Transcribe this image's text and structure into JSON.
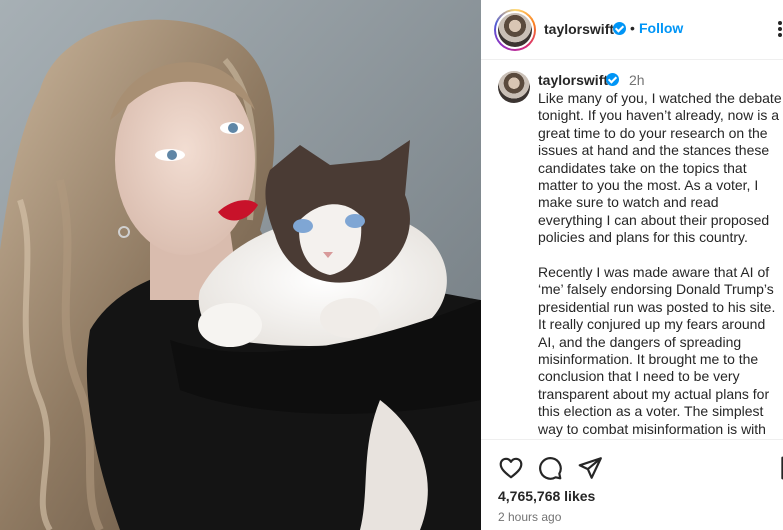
{
  "post": {
    "username": "taylorswift",
    "verified": true,
    "follow_label": "Follow",
    "separator": "•",
    "caption_time": "2h",
    "caption_paragraphs": [
      "Like many of you, I watched the debate tonight. If you haven’t already, now is a great time to do your research on the issues at hand and the stances these candidates take on the topics that matter to you the most. As a voter, I make sure to watch and read everything I can about their proposed policies and plans for this country.",
      "Recently I was made aware that AI of ‘me’ falsely endorsing Donald Trump’s presidential run was posted to his site. It really conjured up my fears around AI, and the dangers of spreading misinformation. It brought me to the conclusion that I need to be very transparent about my actual plans for this election as a voter. The simplest way to combat misinformation is with"
    ],
    "likes": "4,765,768 likes",
    "posted_time": "2 hours ago"
  },
  "icons": {
    "like": "heart-icon",
    "comment": "comment-icon",
    "share": "share-icon",
    "save": "bookmark-icon",
    "more": "more-icon",
    "verified": "verified-badge-icon"
  },
  "colors": {
    "link_blue": "#0095f6",
    "verified_blue": "#0095f6",
    "text": "#262626",
    "muted": "#737373",
    "divider": "#efefef"
  }
}
